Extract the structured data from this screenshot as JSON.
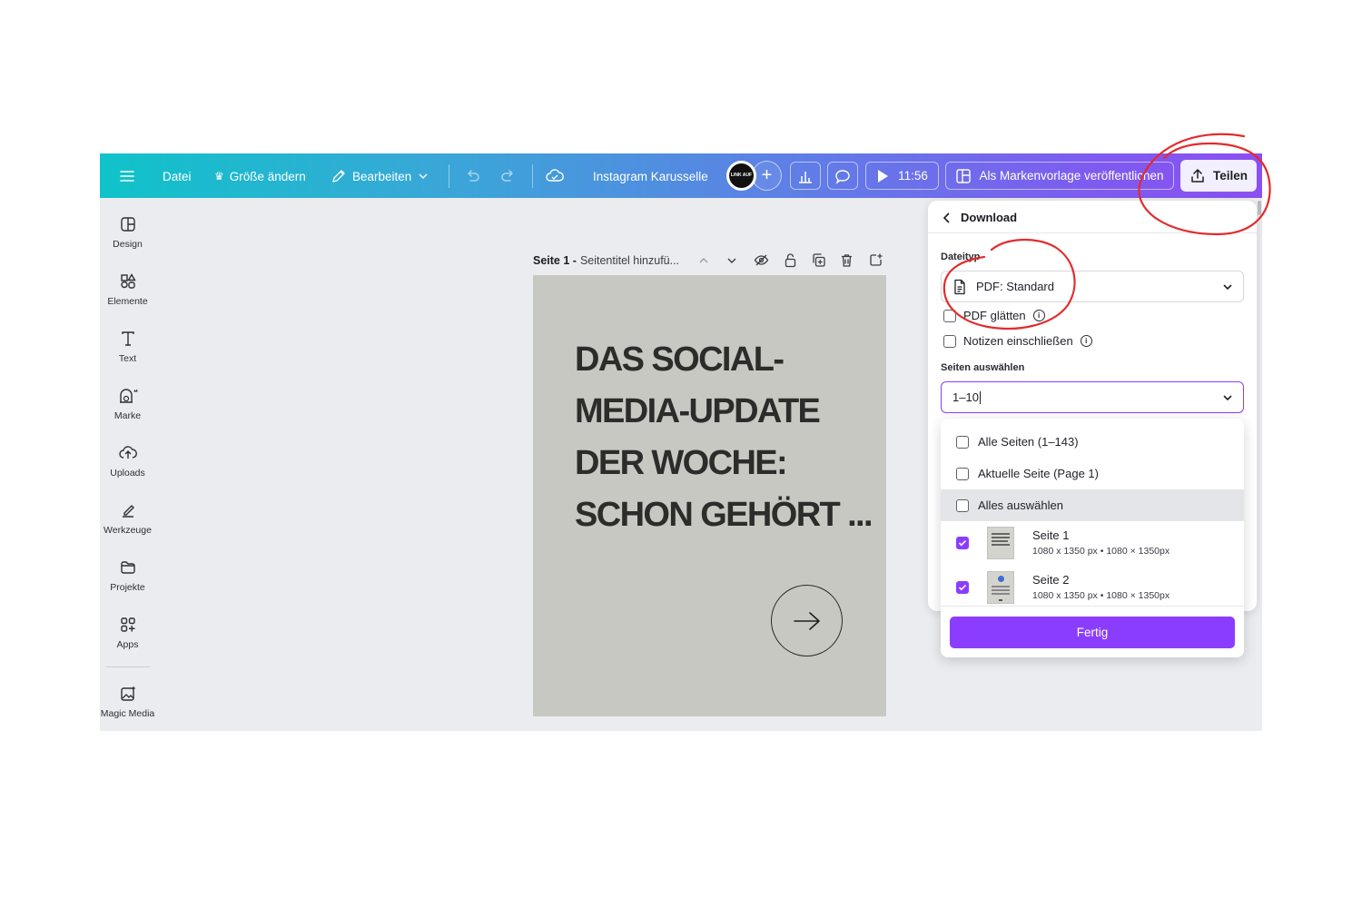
{
  "topbar": {
    "file": "Datei",
    "resize": "Größe ändern",
    "edit": "Bearbeiten",
    "title": "Instagram Karusselle",
    "avatar_text": "LINK AUF",
    "present_time": "11:56",
    "publish_template": "Als Markenvorlage veröffentlichen",
    "share": "Teilen"
  },
  "sidebar": {
    "items": [
      {
        "label": "Design",
        "icon": "design-icon"
      },
      {
        "label": "Elemente",
        "icon": "elements-icon"
      },
      {
        "label": "Text",
        "icon": "text-icon"
      },
      {
        "label": "Marke",
        "icon": "brand-icon"
      },
      {
        "label": "Uploads",
        "icon": "upload-icon"
      },
      {
        "label": "Werkzeuge",
        "icon": "tools-icon"
      },
      {
        "label": "Projekte",
        "icon": "folder-icon"
      },
      {
        "label": "Apps",
        "icon": "apps-icon"
      },
      {
        "label": "Magic Media",
        "icon": "magic-media-icon"
      }
    ]
  },
  "page_header": {
    "page_label": "Seite 1 -",
    "title_placeholder": "Seitentitel hinzufü..."
  },
  "canvas": {
    "headline_lines": [
      "DAS SOCIAL-",
      "MEDIA-UPDATE",
      "DER WOCHE:",
      "SCHON GEHÖRT ..."
    ]
  },
  "download_panel": {
    "back_title": "Download",
    "filetype_label": "Dateityp",
    "filetype_value": "PDF: Standard",
    "flatten_pdf": "PDF glätten",
    "include_notes": "Notizen einschließen",
    "pages_label": "Seiten auswählen",
    "pages_value": "1–10",
    "options": [
      {
        "label": "Alle Seiten (1–143)",
        "checked": false
      },
      {
        "label": "Aktuelle Seite (Page 1)",
        "checked": false
      },
      {
        "label": "Alles auswählen",
        "checked": false
      }
    ],
    "pages": [
      {
        "title": "Seite 1",
        "subtitle": "1080 x 1350 px • 1080 × 1350px",
        "checked": true
      },
      {
        "title": "Seite 2",
        "subtitle": "1080 x 1350 px • 1080 × 1350px",
        "checked": true
      }
    ],
    "done": "Fertig"
  },
  "colors": {
    "accent": "#8b3dff",
    "annotation": "#e32b2b",
    "canvas_bg": "#c8c8c3",
    "workspace_bg": "#ebecf0"
  }
}
